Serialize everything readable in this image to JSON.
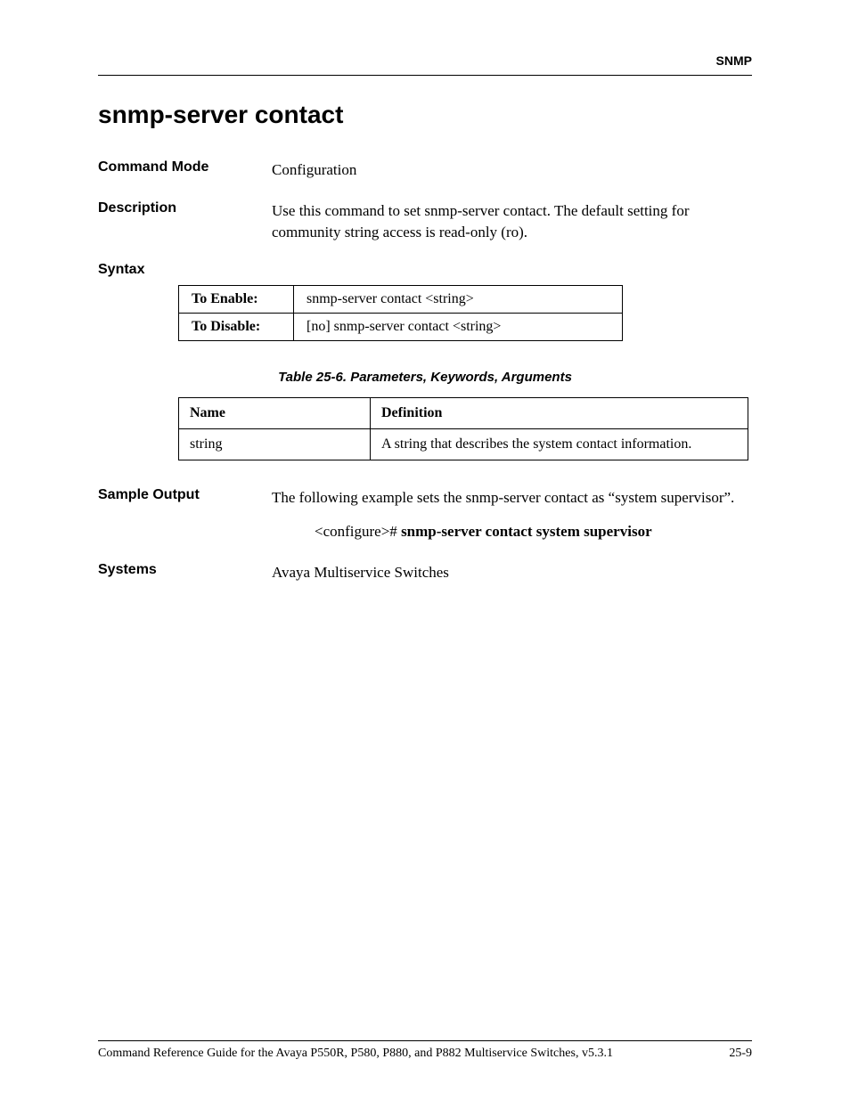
{
  "header": {
    "chapter": "SNMP"
  },
  "title": "snmp-server contact",
  "commandMode": {
    "label": "Command Mode",
    "value": "Configuration"
  },
  "description": {
    "label": "Description",
    "value": "Use this command to set snmp-server contact. The default setting for community string access is read-only (ro)."
  },
  "syntax": {
    "label": "Syntax",
    "rows": [
      {
        "label": "To Enable:",
        "value": "snmp-server contact <string>"
      },
      {
        "label": "To Disable:",
        "value": "[no] snmp-server contact <string>"
      }
    ]
  },
  "paramTable": {
    "caption": "Table 25-6.  Parameters, Keywords, Arguments",
    "headers": [
      "Name",
      "Definition"
    ],
    "rows": [
      {
        "name": "string",
        "definition": "A string that describes the system contact information."
      }
    ]
  },
  "sampleOutput": {
    "label": "Sample Output",
    "intro": "The following example sets the snmp-server contact as “system supervisor”.",
    "prompt": "<configure># ",
    "command": "snmp-server contact system supervisor"
  },
  "systems": {
    "label": "Systems",
    "value": "Avaya Multiservice Switches"
  },
  "footer": {
    "left": "Command Reference Guide for the Avaya P550R, P580, P880, and P882 Multiservice Switches, v5.3.1",
    "right": "25-9"
  }
}
